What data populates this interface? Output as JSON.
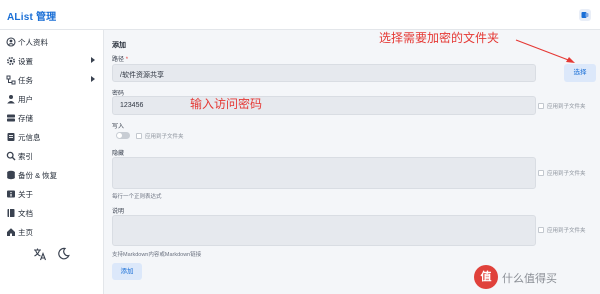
{
  "app": {
    "title": "AList 管理"
  },
  "sidebar": {
    "items": [
      {
        "label": "个人资料",
        "icon": "user-circle-icon",
        "expandable": false
      },
      {
        "label": "设置",
        "icon": "gear-icon",
        "expandable": true
      },
      {
        "label": "任务",
        "icon": "task-icon",
        "expandable": true
      },
      {
        "label": "用户",
        "icon": "user-icon",
        "expandable": false
      },
      {
        "label": "存储",
        "icon": "database-icon",
        "expandable": false
      },
      {
        "label": "元信息",
        "icon": "meta-icon",
        "expandable": false
      },
      {
        "label": "索引",
        "icon": "search-icon",
        "expandable": false
      },
      {
        "label": "备份 & 恢复",
        "icon": "backup-icon",
        "expandable": false
      },
      {
        "label": "关于",
        "icon": "info-icon",
        "expandable": false
      },
      {
        "label": "文档",
        "icon": "book-icon",
        "expandable": false
      },
      {
        "label": "主页",
        "icon": "home-icon",
        "expandable": false
      }
    ],
    "bottom_icons": [
      "translate-icon",
      "moon-icon"
    ]
  },
  "form": {
    "title": "添加",
    "path": {
      "label": "路径",
      "required_mark": "*",
      "value": "/软件资源共享",
      "choose_button": "选择"
    },
    "password": {
      "label": "密码",
      "value": "123456",
      "apply_sub": "应用到子文件夹"
    },
    "write": {
      "label": "写入",
      "enabled": false,
      "apply_sub": "应用到子文件夹"
    },
    "hide": {
      "label": "隐藏",
      "value": "",
      "apply_sub": "应用到子文件夹",
      "hint": "每行一个正则表达式"
    },
    "readme": {
      "label": "说明",
      "value": "",
      "apply_sub": "应用到子文件夹",
      "hint": "支持Markdown内容或Markdown链接"
    },
    "submit_button": "添加"
  },
  "annotations": {
    "select_folder": "选择需要加密的文件夹",
    "enter_password": "输入访问密码",
    "color": "#e53935"
  },
  "watermark": {
    "badge": "值",
    "text": "什么值得买"
  },
  "colors": {
    "accent": "#1a6fd6",
    "field_bg": "#e6e9ee",
    "page_bg": "#f4f6f9"
  }
}
